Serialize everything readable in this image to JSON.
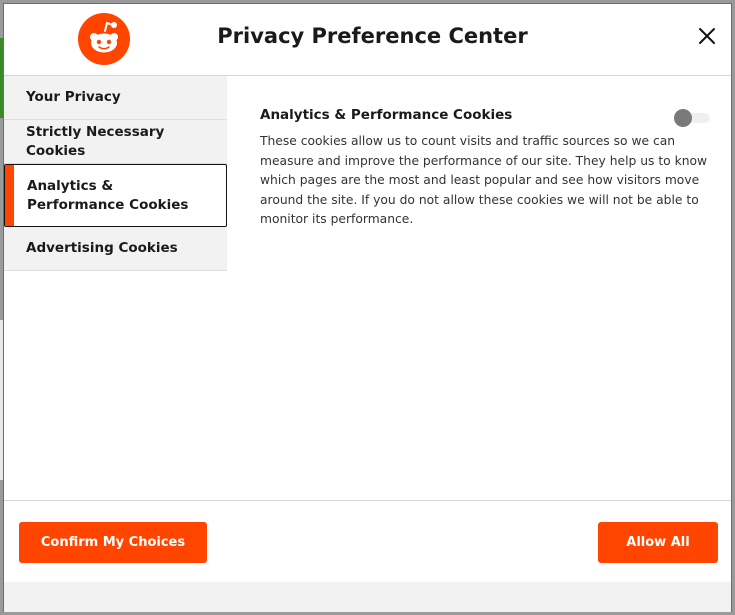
{
  "dialog": {
    "title": "Privacy Preference Center",
    "logo_icon": "reddit-alien-icon",
    "close_icon": "close-icon"
  },
  "sidebar": {
    "items": [
      {
        "label": "Your Privacy",
        "active": false
      },
      {
        "label": "Strictly Necessary Cookies",
        "active": false
      },
      {
        "label": "Analytics & Performance Cookies",
        "active": true
      },
      {
        "label": "Advertising Cookies",
        "active": false
      }
    ]
  },
  "content": {
    "title": "Analytics & Performance Cookies",
    "description": "These cookies allow us to count visits and traffic sources so we can measure and improve the performance of our site. They help us to know which pages are the most and least popular and see how visitors move around the site. If you do not allow these cookies we will not be able to monitor its performance.",
    "toggle_on": false
  },
  "footer": {
    "confirm_label": "Confirm My Choices",
    "allow_all_label": "Allow All"
  },
  "colors": {
    "accent": "#ff4500",
    "toggle_knob": "#7a7a7a"
  }
}
